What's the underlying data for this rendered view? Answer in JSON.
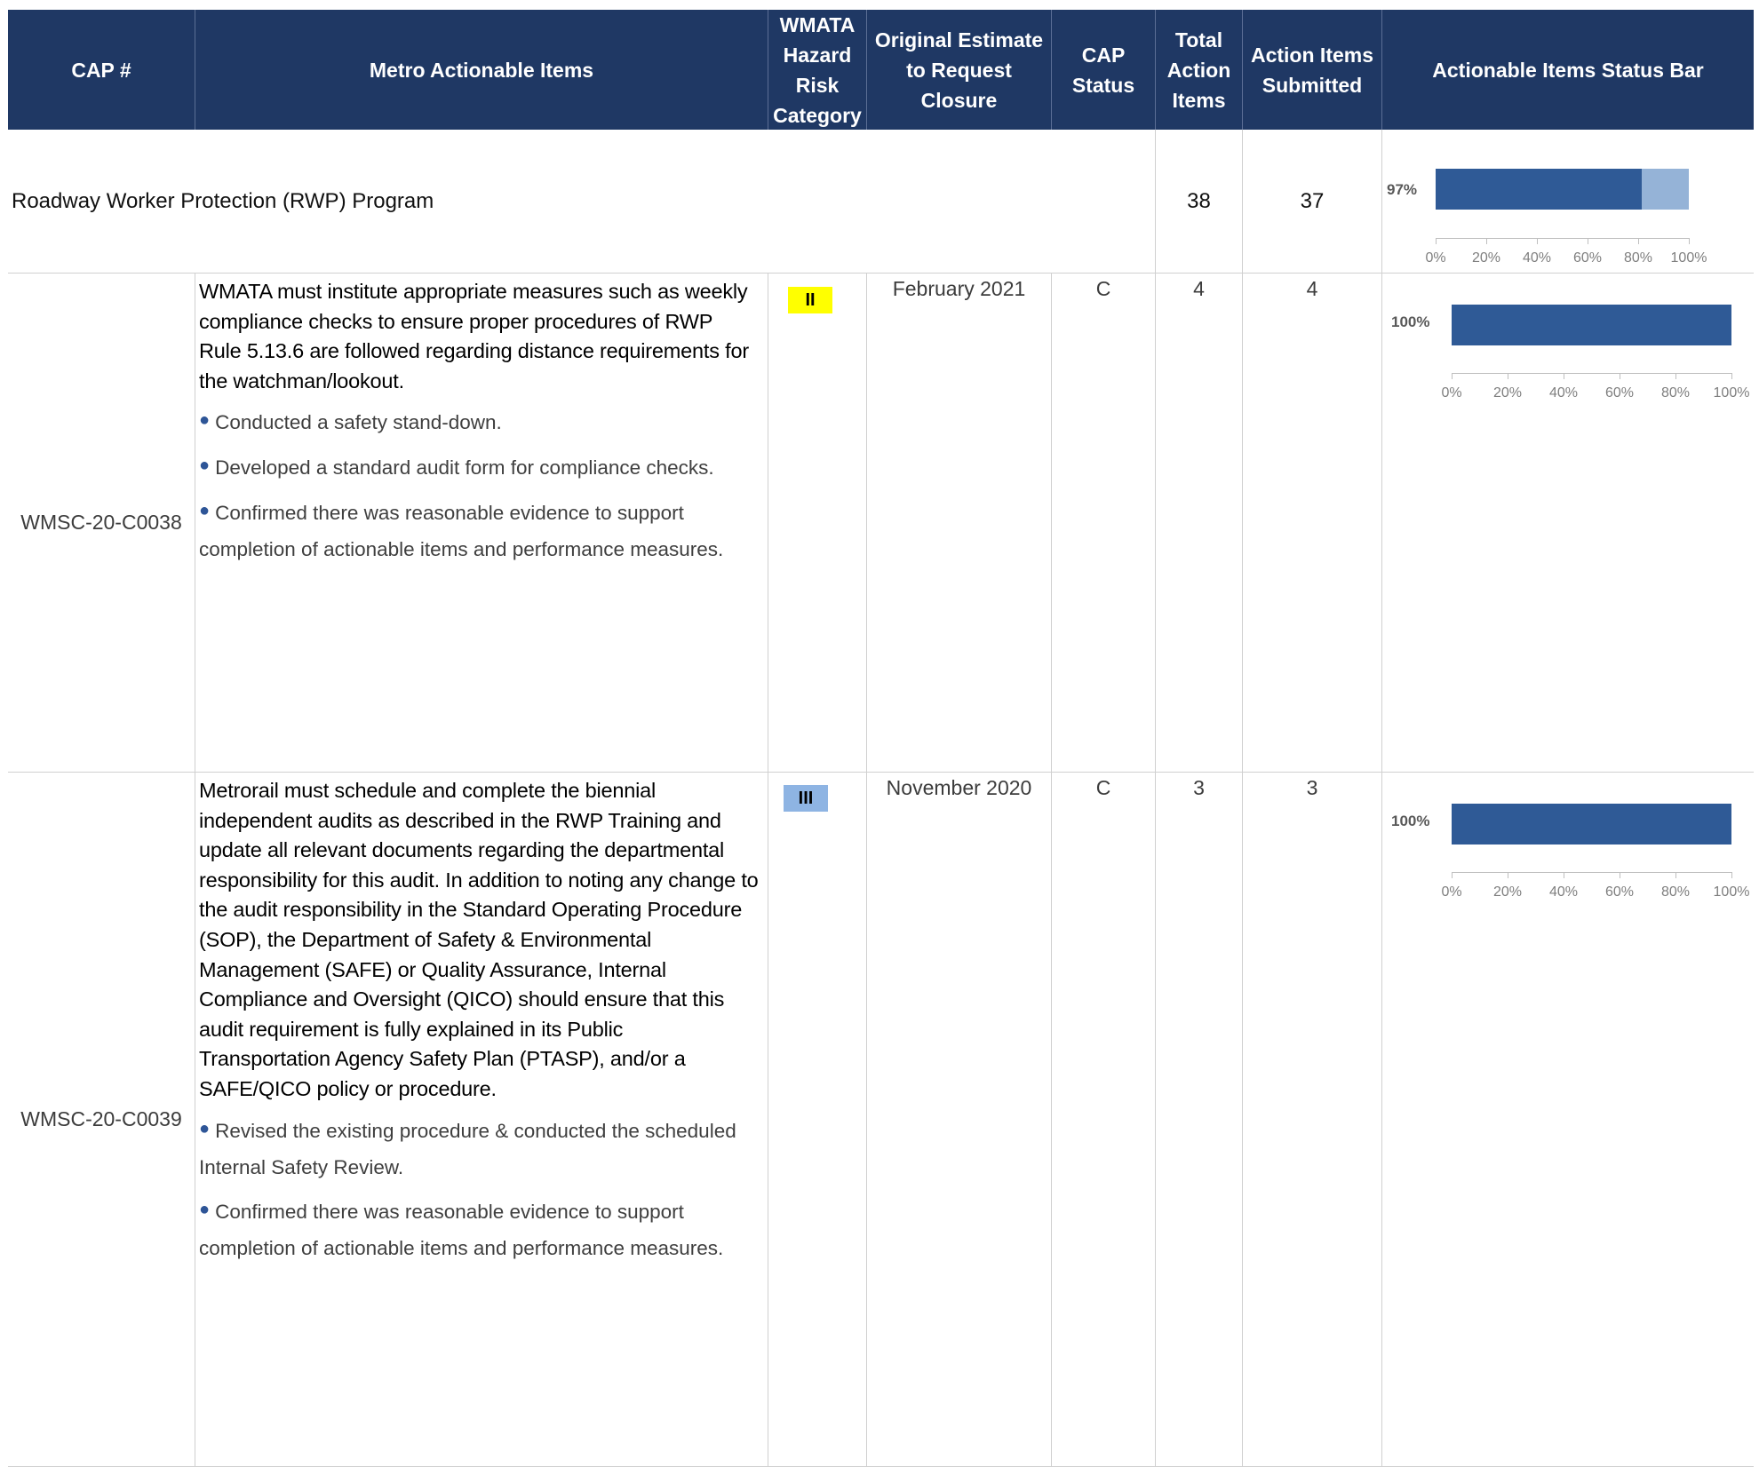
{
  "header": {
    "cap_number": "CAP #",
    "actionable_items": "Metro Actionable Items",
    "hazard": "WMATA Hazard Risk Category",
    "estimate": "Original Estimate to Request Closure",
    "cap_status": "CAP Status",
    "total_items": "Total Action Items",
    "submitted": "Action Items Submitted",
    "status_bar": "Actionable Items Status Bar"
  },
  "program": {
    "name": "Roadway Worker Protection (RWP) Program",
    "total": "38",
    "submitted": "37",
    "percent_label": "97%",
    "fraction": 0.97
  },
  "axis_ticks": [
    "0%",
    "20%",
    "40%",
    "60%",
    "80%",
    "100%"
  ],
  "rows": [
    {
      "cap": "WMSC-20-C0038",
      "description": "WMATA must institute appropriate measures such as weekly compliance checks to ensure proper procedures of RWP Rule 5.13.6 are followed regarding distance requirements for the watchman/lookout.",
      "bullets": [
        "Conducted a safety stand-down.",
        "Developed a standard audit form for compliance checks.",
        "Confirmed there was reasonable evidence to support completion of actionable items and performance measures."
      ],
      "hazard": "II",
      "hazard_color": "#ffff00",
      "estimate": "February 2021",
      "status": "C",
      "total": "4",
      "submitted": "4",
      "percent_label": "100%",
      "fraction": 1.0
    },
    {
      "cap": "WMSC-20-C0039",
      "description": "Metrorail must schedule and complete the biennial independent audits as described in the RWP Training and update all relevant documents regarding the departmental responsibility for this audit. In addition to noting any change to the audit responsibility in the Standard Operating Procedure (SOP), the Department of Safety & Environmental Management (SAFE) or Quality Assurance, Internal Compliance and Oversight (QICO) should ensure that this audit requirement is fully explained in its Public Transportation Agency Safety Plan (PTASP), and/or a SAFE/QICO policy or procedure.",
      "bullets": [
        "Revised the existing procedure & conducted the scheduled Internal Safety Review.",
        "Confirmed there was reasonable evidence to support completion of actionable items and performance measures."
      ],
      "hazard": "III",
      "hazard_color": "#8eb4e3",
      "estimate": "November 2020",
      "status": "C",
      "total": "3",
      "submitted": "3",
      "percent_label": "100%",
      "fraction": 1.0
    }
  ],
  "colors": {
    "header_bg": "#1f3864",
    "bar_complete": "#2f5a96",
    "bar_remaining": "#95b3d7"
  }
}
